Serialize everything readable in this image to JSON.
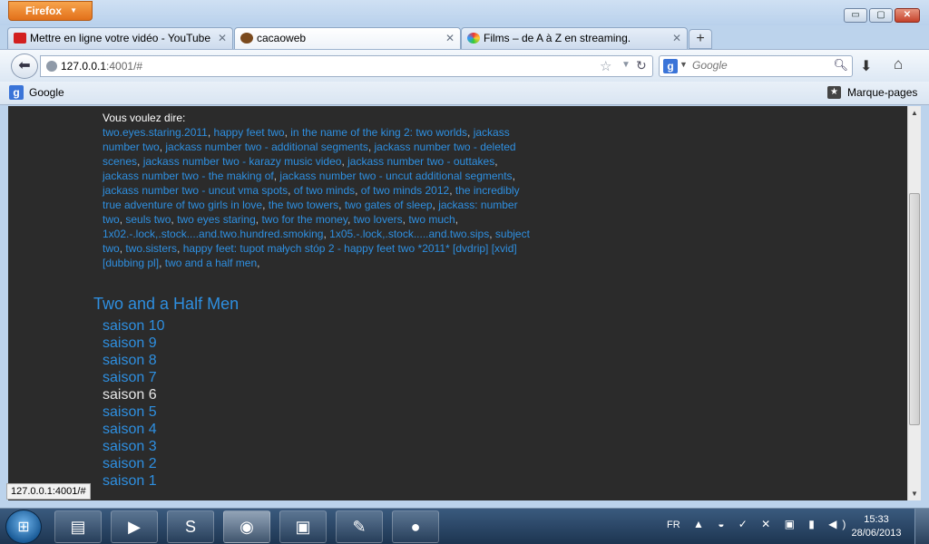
{
  "window": {
    "menu_label": "Firefox",
    "min_glyph": "▭",
    "max_glyph": "▢",
    "close_glyph": "✕"
  },
  "tabs": [
    {
      "title": "Mettre en ligne votre vidéo - YouTube",
      "icon": "youtube-icon",
      "active": false
    },
    {
      "title": "cacaoweb",
      "icon": "cacaoweb-icon",
      "active": true
    },
    {
      "title": "Films – de A à Z en streaming.",
      "icon": "films-icon",
      "active": false
    }
  ],
  "newtab_glyph": "+",
  "nav": {
    "url_host": "127.0.0.1",
    "url_rest": ":4001/#",
    "search_placeholder": "Google",
    "search_engine_letter": "g"
  },
  "bookmarks": {
    "google": "Google",
    "pages": "Marque-pages"
  },
  "content": {
    "did_you_mean_label": "Vous voulez dire:",
    "suggestions": [
      "two.eyes.staring.2011",
      "happy feet two",
      "in the name of the king 2: two worlds",
      "jackass number two",
      "jackass number two - additional segments",
      "jackass number two - deleted scenes",
      "jackass number two - karazy music video",
      "jackass number two - outtakes",
      "jackass number two - the making of",
      "jackass number two - uncut additional segments",
      "jackass number two - uncut vma spots",
      "of two minds",
      "of two minds 2012",
      "the incredibly true adventure of two girls in love",
      "the two towers",
      "two gates of sleep",
      "jackass: number two",
      "seuls two",
      "two eyes staring",
      "two for the money",
      "two lovers",
      "two much",
      "1x02.-.lock,.stock....and.two.hundred.smoking",
      "1x05.-.lock,.stock.....and.two.sips",
      "subject two",
      "two.sisters",
      "happy feet: tupot małych stóp 2 - happy feet two *2011* [dvdrip] [xvid] [dubbing pl]",
      "two and a half men"
    ],
    "show_title": "Two and a Half Men",
    "seasons": [
      "saison 10",
      "saison 9",
      "saison 8",
      "saison 7",
      "saison 6",
      "saison 5",
      "saison 4",
      "saison 3",
      "saison 2",
      "saison 1"
    ],
    "current_season_index": 4,
    "link_color": "#2e8fe0"
  },
  "status_url": "127.0.0.1:4001/#",
  "taskbar": {
    "items": [
      {
        "name": "explorer-icon",
        "glyph": "▤"
      },
      {
        "name": "media-player-icon",
        "glyph": "▶"
      },
      {
        "name": "skype-icon",
        "glyph": "S"
      },
      {
        "name": "firefox-icon",
        "glyph": "◉"
      },
      {
        "name": "app-icon",
        "glyph": "▣"
      },
      {
        "name": "notepad-icon",
        "glyph": "✎"
      },
      {
        "name": "recorder-icon",
        "glyph": "●"
      }
    ],
    "lang": "FR",
    "tray": "▲ ◒ ✓ ✕ ▣ ▮ ◀)",
    "time": "15:33",
    "date": "28/06/2013"
  }
}
